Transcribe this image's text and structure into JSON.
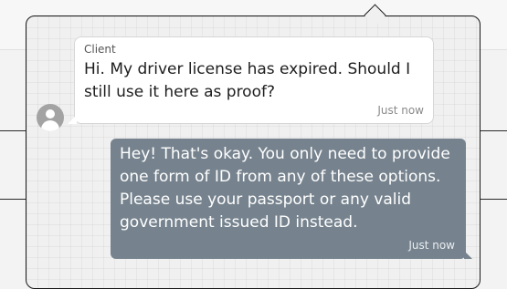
{
  "chat": {
    "incoming": {
      "sender": "Client",
      "text": "Hi. My driver license has expired. Should I still use it here as proof?",
      "time": "Just now",
      "avatar_icon": "user-avatar-icon"
    },
    "outgoing": {
      "text": "Hey! That's okay. You only need to provide one form of ID from any of these options. Please use your passport or any valid government issued ID instead.",
      "time": "Just now"
    }
  },
  "colors": {
    "outgoing_bubble": "#76838e",
    "incoming_bubble": "#ffffff",
    "avatar": "#a3a3a3"
  }
}
